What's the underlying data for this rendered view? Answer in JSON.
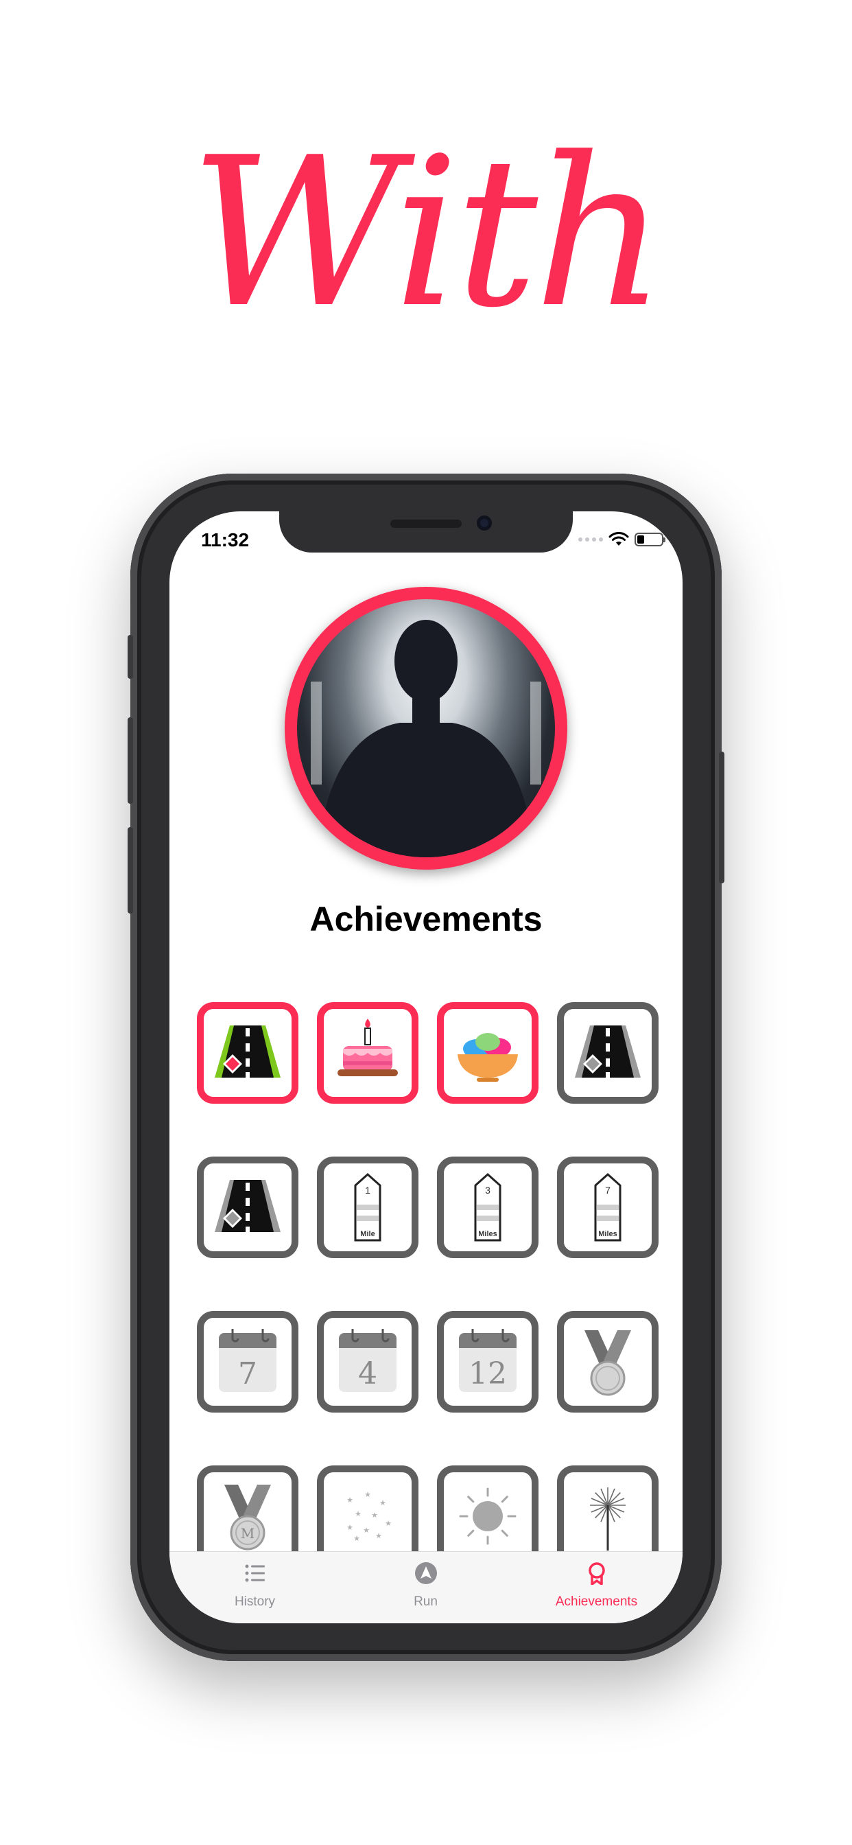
{
  "headline": "With",
  "status_bar": {
    "time": "11:32"
  },
  "profile": {
    "image": "silhouette-avatar"
  },
  "page_title": "Achievements",
  "colors": {
    "accent": "#fb2d55",
    "locked": "#5f5f5f",
    "unlocked": "#fb2d55"
  },
  "badges": [
    {
      "name": "road-diamond-badge",
      "unlocked": true
    },
    {
      "name": "birthday-cake-badge",
      "unlocked": true
    },
    {
      "name": "easter-eggs-bowl-badge",
      "unlocked": true
    },
    {
      "name": "road-diamond-badge",
      "unlocked": false
    },
    {
      "name": "road-diamond-badge",
      "unlocked": false
    },
    {
      "name": "mile-marker-badge",
      "unlocked": false,
      "number": "1",
      "unit": "Mile"
    },
    {
      "name": "mile-marker-badge",
      "unlocked": false,
      "number": "3",
      "unit": "Miles"
    },
    {
      "name": "mile-marker-badge",
      "unlocked": false,
      "number": "7",
      "unit": "Miles"
    },
    {
      "name": "calendar-badge",
      "unlocked": false,
      "number": "7"
    },
    {
      "name": "calendar-badge",
      "unlocked": false,
      "number": "4"
    },
    {
      "name": "calendar-badge",
      "unlocked": false,
      "number": "12"
    },
    {
      "name": "medal-badge",
      "unlocked": false
    },
    {
      "name": "medal-badge",
      "unlocked": false,
      "letter": "M"
    },
    {
      "name": "stars-badge",
      "unlocked": false
    },
    {
      "name": "sun-badge",
      "unlocked": false
    },
    {
      "name": "sparkler-badge",
      "unlocked": false
    }
  ],
  "tabbar": {
    "tabs": [
      {
        "label": "History",
        "icon": "list-icon",
        "active": false
      },
      {
        "label": "Run",
        "icon": "navigation-arrow-icon",
        "active": false
      },
      {
        "label": "Achievements",
        "icon": "ribbon-award-icon",
        "active": true
      }
    ]
  }
}
